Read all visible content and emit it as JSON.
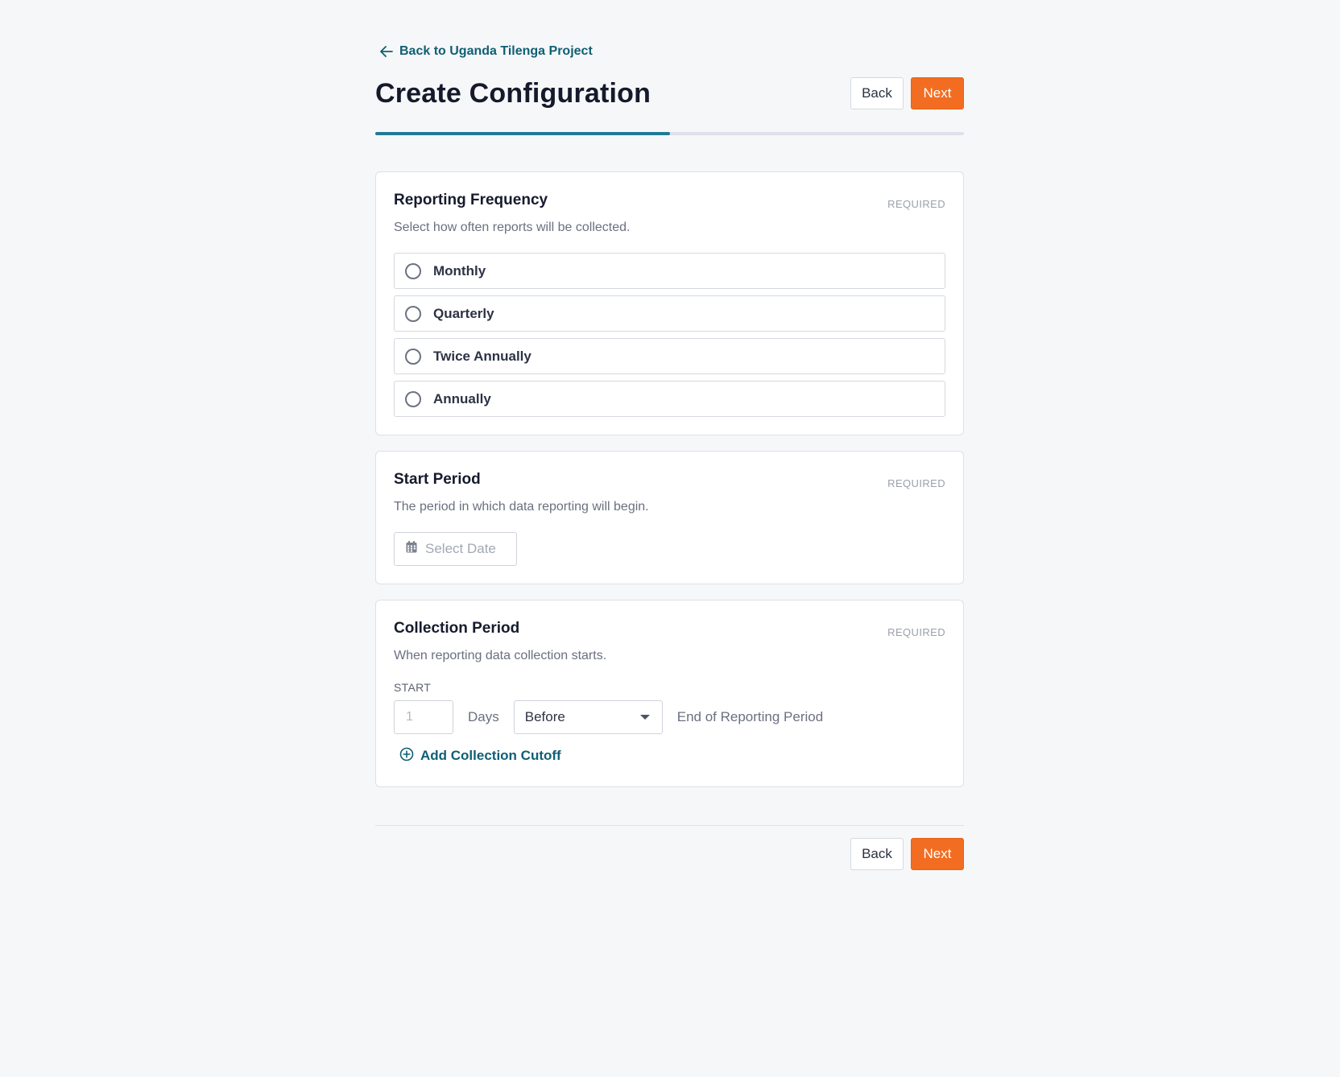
{
  "nav": {
    "back_link_label": "Back to Uganda Tilenga Project"
  },
  "header": {
    "title": "Create Configuration",
    "back_label": "Back",
    "next_label": "Next"
  },
  "progress": {
    "fraction": 0.5
  },
  "reporting_frequency": {
    "title": "Reporting Frequency",
    "required": "REQUIRED",
    "description": "Select how often reports will be collected.",
    "options": [
      {
        "label": "Monthly"
      },
      {
        "label": "Quarterly"
      },
      {
        "label": "Twice Annually"
      },
      {
        "label": "Annually"
      }
    ]
  },
  "start_period": {
    "title": "Start Period",
    "required": "REQUIRED",
    "description": "The period in which data reporting will begin.",
    "date_placeholder": "Select Date"
  },
  "collection_period": {
    "title": "Collection Period",
    "required": "REQUIRED",
    "description": "When reporting data collection starts.",
    "start_label": "START",
    "days_placeholder": "1",
    "days_label": "Days",
    "relation_value": "Before",
    "end_label": "End of Reporting Period",
    "add_cutoff_label": "Add Collection Cutoff"
  },
  "footer": {
    "back_label": "Back",
    "next_label": "Next"
  },
  "colors": {
    "accent": "#f26d21",
    "link": "#0f5f73",
    "progress": "#1f7a93"
  }
}
